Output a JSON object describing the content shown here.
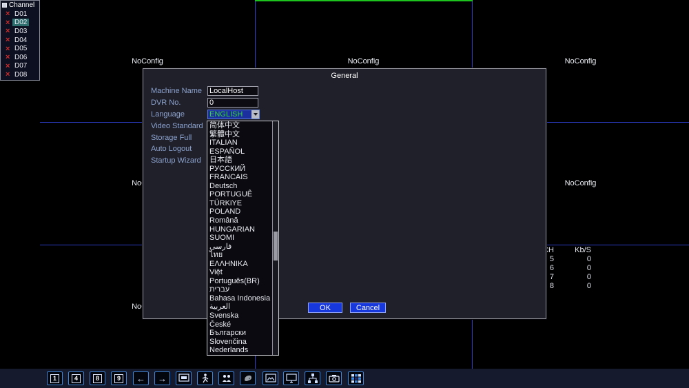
{
  "sidebar": {
    "title": "Channel",
    "x_glyph": "×",
    "channels": [
      {
        "label": "D01",
        "selected": false
      },
      {
        "label": "D02",
        "selected": true
      },
      {
        "label": "D03",
        "selected": false
      },
      {
        "label": "D04",
        "selected": false
      },
      {
        "label": "D05",
        "selected": false
      },
      {
        "label": "D06",
        "selected": false
      },
      {
        "label": "D07",
        "selected": false
      },
      {
        "label": "D08",
        "selected": false
      }
    ]
  },
  "video_grid": {
    "no_config_label": "NoConfig"
  },
  "bitrate_table": {
    "col1_header": "CH",
    "col2_header": "Kb/S",
    "rows": [
      {
        "ch": "5",
        "kbs": "0"
      },
      {
        "ch": "6",
        "kbs": "0"
      },
      {
        "ch": "7",
        "kbs": "0"
      },
      {
        "ch": "8",
        "kbs": "0"
      }
    ]
  },
  "dialog": {
    "title": "General",
    "fields": [
      {
        "label": "Machine Name",
        "value": "LocalHost"
      },
      {
        "label": "DVR No.",
        "value": "0"
      },
      {
        "label": "Language",
        "value": "ENGLISH"
      },
      {
        "label": "Video Standard"
      },
      {
        "label": "Storage Full"
      },
      {
        "label": "Auto Logout"
      },
      {
        "label": "Startup Wizard"
      }
    ],
    "language_options": [
      "简体中文",
      "繁體中文",
      "ITALIAN",
      "ESPAÑOL",
      "日本語",
      "РУССКИЙ",
      "FRANCAIS",
      "Deutsch",
      "PORTUGUÊ",
      "TÜRKiYE",
      "POLAND",
      "Română",
      "HUNGARIAN",
      "SUOMI",
      "فارسى",
      "ไทย",
      "ΕΛΛΗΝΙΚΑ",
      "Việt",
      "Português(BR)",
      "עברית",
      "Bahasa Indonesia",
      "العربية",
      "Svenska",
      "České",
      "Български",
      "Slovenčina",
      "Nederlands"
    ],
    "ok_label": "OK",
    "cancel_label": "Cancel"
  },
  "toolbar": {
    "buttons": [
      {
        "name": "view-1",
        "label": "1"
      },
      {
        "name": "view-4",
        "label": "4"
      },
      {
        "name": "view-8",
        "label": "8"
      },
      {
        "name": "view-9",
        "label": "9"
      },
      {
        "name": "page-left",
        "glyph": "←"
      },
      {
        "name": "page-right",
        "glyph": "→"
      },
      {
        "name": "screen"
      },
      {
        "name": "patrol"
      },
      {
        "name": "users"
      },
      {
        "name": "paint"
      },
      {
        "name": "image"
      },
      {
        "name": "monitor"
      },
      {
        "name": "network"
      },
      {
        "name": "camera"
      },
      {
        "name": "mosaic"
      }
    ]
  },
  "colors": {
    "grid_line": "#2c3cc4",
    "grid_accent_green": "#1ec41e",
    "selected_channel_bg": "#2e6e6e",
    "dialog_button_blue": "#1638dc",
    "toolbar_button_border": "#3f86d9",
    "language_value_green": "#38d838",
    "channel_x_red": "#d42a2a"
  }
}
